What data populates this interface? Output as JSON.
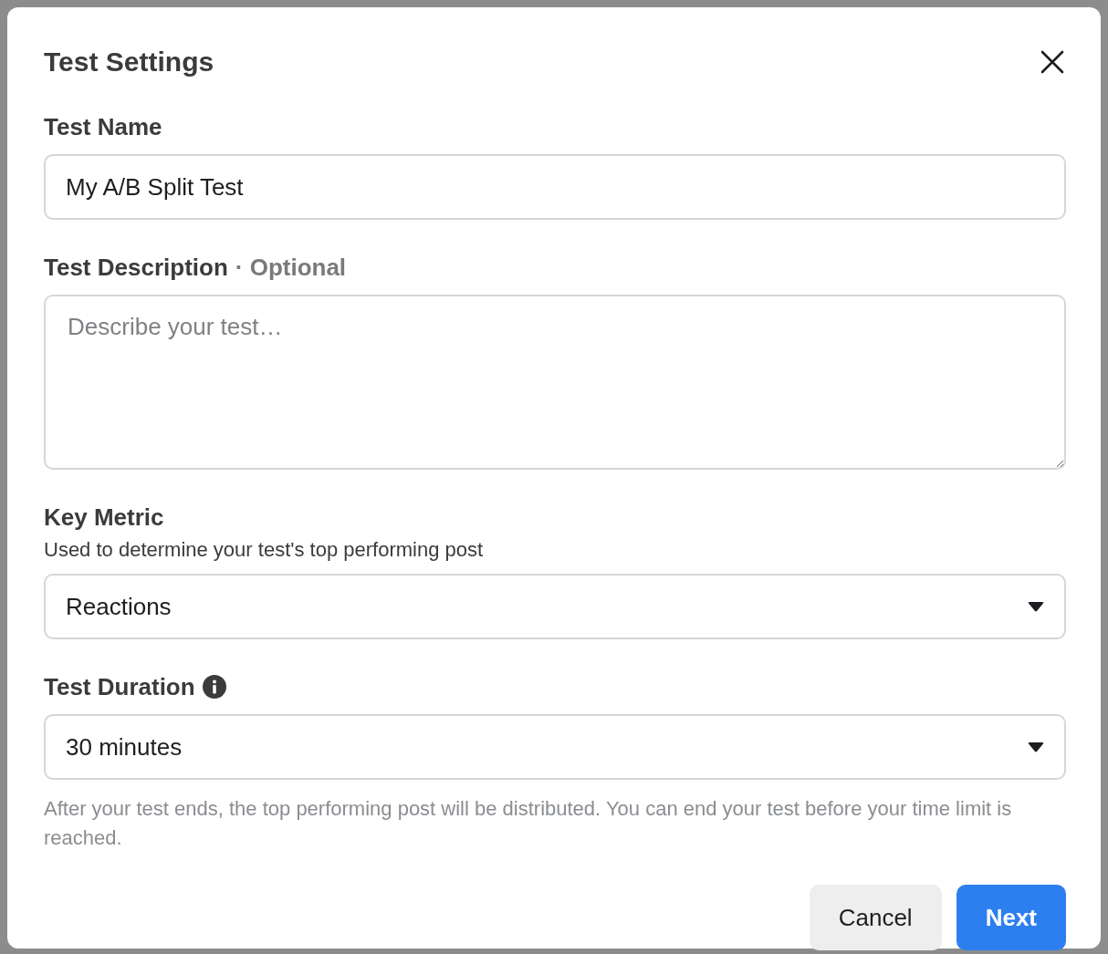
{
  "dialog": {
    "title": "Test Settings"
  },
  "fields": [
    {
      "kind": "text",
      "label": "Test Name",
      "value": "My A/B Split Test"
    },
    {
      "kind": "textarea",
      "label": "Test Description",
      "optional_note": "· Optional",
      "placeholder": "Describe your test…"
    },
    {
      "kind": "select",
      "label": "Key Metric",
      "description": "Used to determine your test's top performing post",
      "value": "Reactions"
    },
    {
      "kind": "select",
      "label": "Test Duration",
      "info": true,
      "value": "30 minutes",
      "help": "After your test ends, the top performing post will be distributed. You can end your test before your time limit is reached."
    }
  ],
  "buttons": [
    {
      "label": "Cancel",
      "kind": "secondary"
    },
    {
      "label": "Next",
      "kind": "primary"
    }
  ]
}
